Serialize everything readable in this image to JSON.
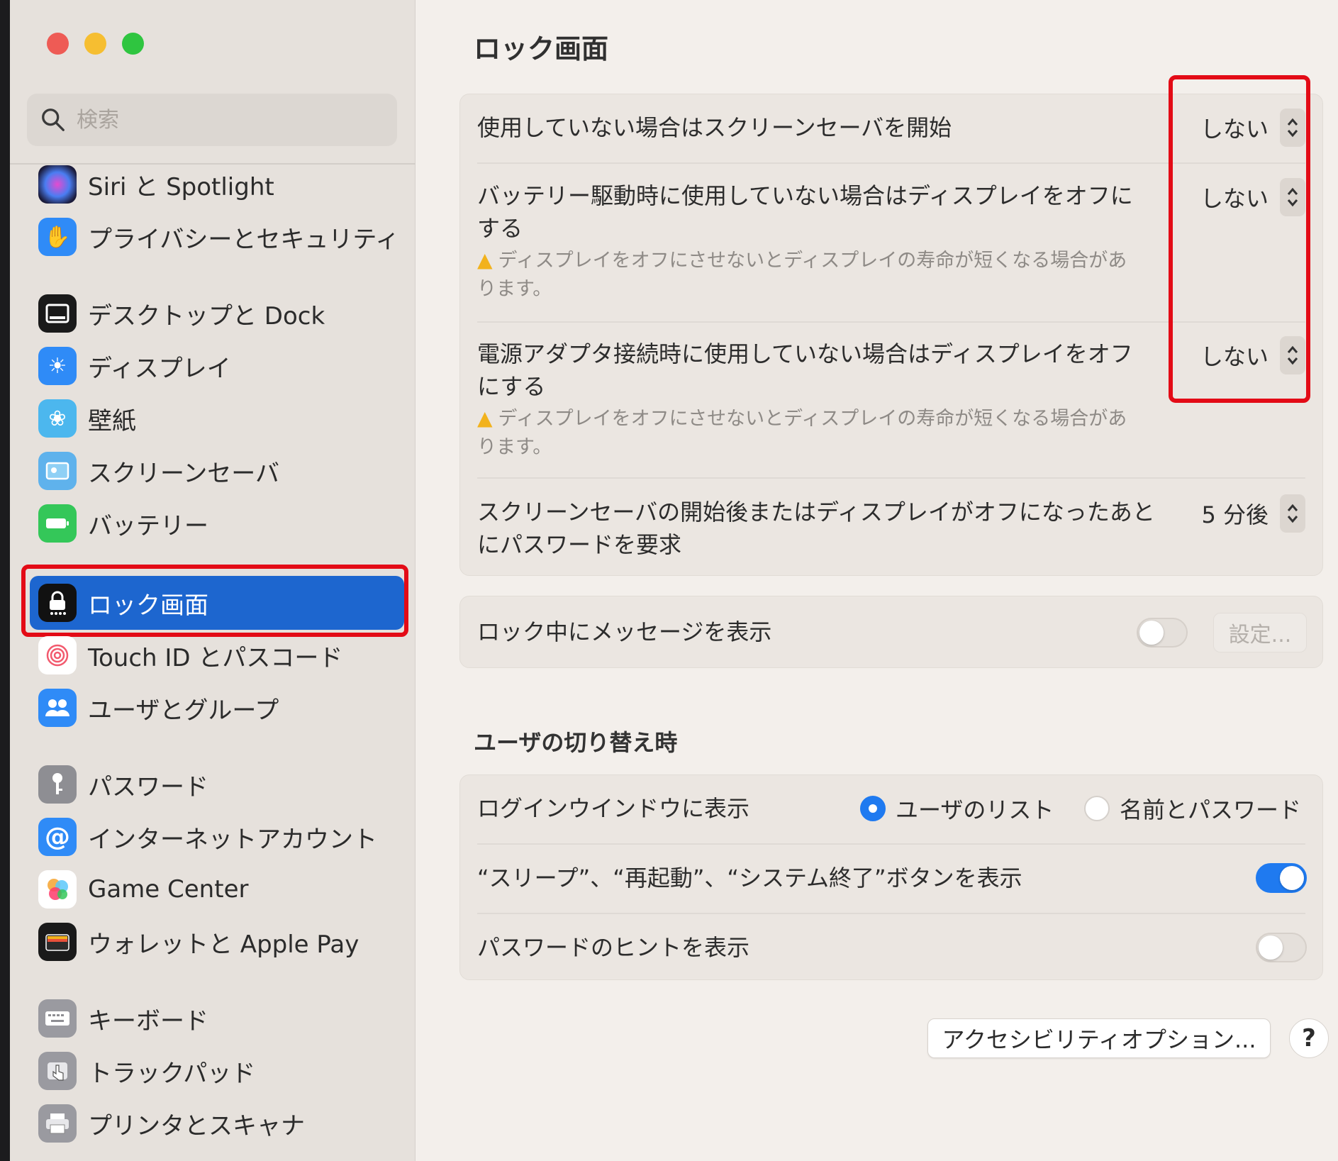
{
  "sidebar": {
    "search_placeholder": "検索",
    "items": [
      {
        "label": "Siri と Spotlight",
        "icon": "siri-icon"
      },
      {
        "label": "プライバシーとセキュリティ",
        "icon": "hand-icon"
      },
      {
        "label": "デスクトップと Dock",
        "icon": "desktop-dock-icon"
      },
      {
        "label": "ディスプレイ",
        "icon": "sun-icon"
      },
      {
        "label": "壁紙",
        "icon": "flower-icon"
      },
      {
        "label": "スクリーンセーバ",
        "icon": "screensaver-icon"
      },
      {
        "label": "バッテリー",
        "icon": "battery-icon"
      },
      {
        "label": "ロック画面",
        "icon": "lock-icon",
        "selected": true
      },
      {
        "label": "Touch ID とパスコード",
        "icon": "fingerprint-icon"
      },
      {
        "label": "ユーザとグループ",
        "icon": "users-icon"
      },
      {
        "label": "パスワード",
        "icon": "key-icon"
      },
      {
        "label": "インターネットアカウント",
        "icon": "at-icon"
      },
      {
        "label": "Game Center",
        "icon": "game-center-icon"
      },
      {
        "label": "ウォレットと Apple Pay",
        "icon": "wallet-icon"
      },
      {
        "label": "キーボード",
        "icon": "keyboard-icon"
      },
      {
        "label": "トラックパッド",
        "icon": "trackpad-icon"
      },
      {
        "label": "プリンタとスキャナ",
        "icon": "printer-icon"
      }
    ]
  },
  "main": {
    "title": "ロック画面",
    "display_group": {
      "screensaver_label": "使用していない場合はスクリーンセーバを開始",
      "screensaver_value": "しない",
      "battery_label_1": "バッテリー駆動時に使用していない場合はディスプレイをオフに",
      "battery_label_2": "する",
      "battery_value": "しない",
      "battery_warning_1": "ディスプレイをオフにさせないとディスプレイの寿命が短くなる場合があ",
      "battery_warning_2": "ります。",
      "adapter_label_1": "電源アダプタ接続時に使用していない場合はディスプレイをオフ",
      "adapter_label_2": "にする",
      "adapter_value": "しない",
      "adapter_warning_1": "ディスプレイをオフにさせないとディスプレイの寿命が短くなる場合があ",
      "adapter_warning_2": "ります。",
      "password_label_1": "スクリーンセーバの開始後またはディスプレイがオフになったあと",
      "password_label_2": "にパスワードを要求",
      "password_value": "5 分後"
    },
    "message_group": {
      "label": "ロック中にメッセージを表示",
      "toggle_on": false,
      "settings_button": "設定..."
    },
    "user_switch": {
      "section_title": "ユーザの切り替え時",
      "login_window_label": "ログインウインドウに表示",
      "option_list": "ユーザのリスト",
      "option_name_password": "名前とパスワード",
      "selected_option": "ユーザのリスト",
      "sleep_buttons_label": "“スリープ”、“再起動”、“システム終了”ボタンを表示",
      "sleep_buttons_on": true,
      "password_hint_label": "パスワードのヒントを表示",
      "password_hint_on": false
    },
    "accessibility_button": "アクセシビリティオプション...",
    "help_button": "?"
  },
  "colors": {
    "accent": "#1f7af0",
    "selection": "#1d66cf",
    "highlight_box": "#e30b16"
  }
}
